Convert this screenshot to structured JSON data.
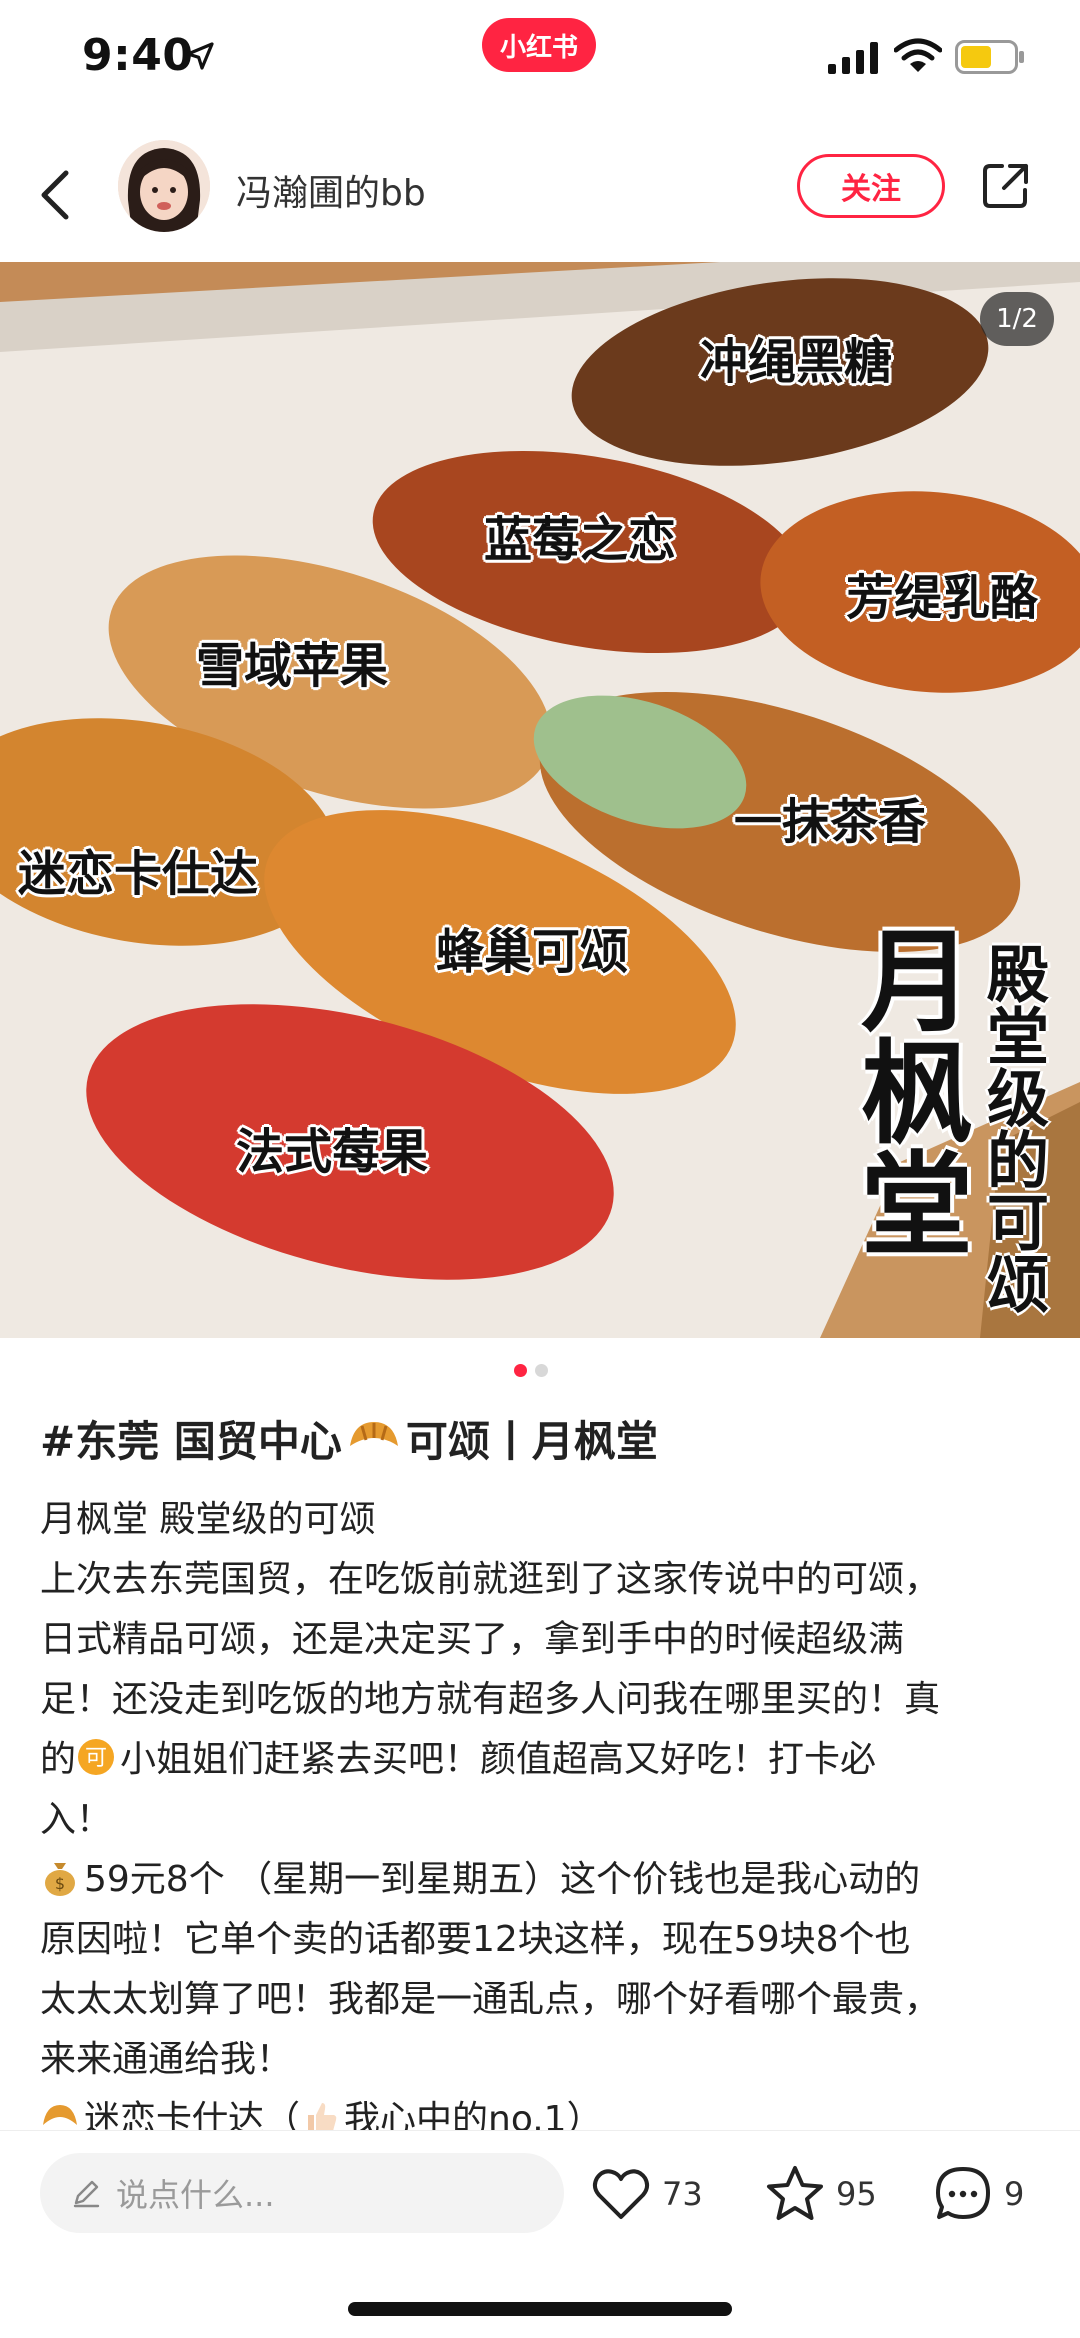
{
  "status_bar": {
    "time": "9:40",
    "app_badge": "小红书"
  },
  "header": {
    "author": "冯瀚圃的bb",
    "follow_label": "关注"
  },
  "hero": {
    "counter": "1/2",
    "flavors": [
      "冲绳黑糖",
      "蓝莓之恋",
      "芳缇乳酪",
      "雪域苹果",
      "一抹茶香",
      "迷恋卡仕达",
      "蜂巢可颂",
      "法式莓果"
    ],
    "brand_big": "月枫堂",
    "brand_sub": "殿堂级的可颂"
  },
  "post": {
    "title_prefix": "#东莞 国贸中心",
    "title_suffix": "可颂丨月枫堂",
    "lines": [
      "月枫堂 殿堂级的可颂",
      "上次去东莞国贸，在吃饭前就逛到了这家传说中的可颂，",
      "日式精品可颂，还是决定买了，拿到手中的时候超级满",
      "足！还没走到吃饭的地方就有超多人问我在哪里买的！真",
      "小姐姐们赶紧去买吧！颜值超高又好吃！打卡必",
      "入！",
      "59元8个 （星期一到星期五）这个价钱也是我心动的",
      "原因啦！它单个卖的话都要12块这样，现在59块8个也",
      "太太太划算了吧！我都是一通乱点，哪个好看哪个最贵，",
      "来来通通给我！",
      "迷恋卡仕达（",
      "我心中的no.1）"
    ],
    "line4_prefix": "的"
  },
  "bottom_bar": {
    "comment_placeholder": "说点什么...",
    "likes": "73",
    "collects": "95",
    "comments": "9"
  },
  "colors": {
    "brand_red": "#ff2442"
  }
}
